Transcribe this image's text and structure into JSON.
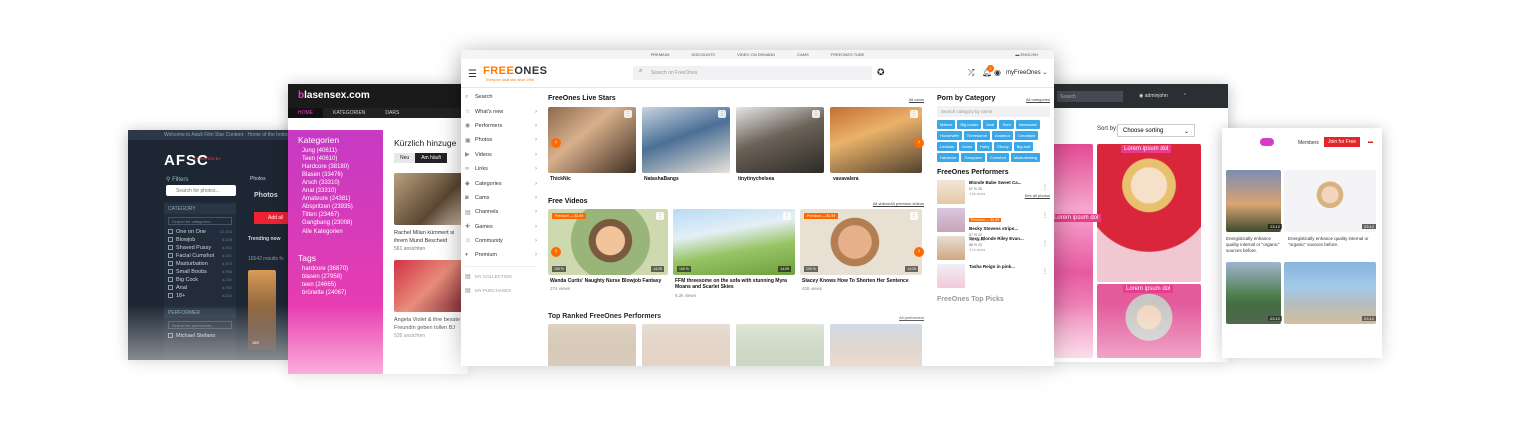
{
  "afsc": {
    "top_notice": "Welcome to Adult Film Star Content - Home of the hottest B...",
    "logo": "AFSC",
    "logo_sub": "POWERED BY",
    "filters_label": "Filters",
    "search_photos_placeholder": "Search for photos...",
    "photos_crumb": "Photos",
    "category_header": "CATEGORY",
    "category_search_placeholder": "Search for categories...",
    "categories": [
      {
        "label": "One on One",
        "count": "12,443"
      },
      {
        "label": "Blowjob",
        "count": "8,028"
      },
      {
        "label": "Shaved Pussy",
        "count": "6,542"
      },
      {
        "label": "Facial Cumshot",
        "count": "6,021"
      },
      {
        "label": "Masturbation",
        "count": "5,574"
      },
      {
        "label": "Small Boobs",
        "count": "4,996"
      },
      {
        "label": "Big Cock",
        "count": "4,232"
      },
      {
        "label": "Anal",
        "count": "3,992"
      },
      {
        "label": "18+",
        "count": "3,524"
      }
    ],
    "performer_header": "PERFORMER",
    "performer_search_placeholder": "Search for performers...",
    "performer_first": "Michael Stefano",
    "photos_title": "Photos",
    "add_button": "Add all",
    "trending_label": "Trending now",
    "results_text": "16542 results fo",
    "thumb_badge": "189"
  },
  "blasen": {
    "logo_b": "b",
    "logo_rest": "lasensex.com",
    "nav": [
      "HOME",
      "KATEGORIEN",
      "DARS"
    ],
    "categories_title": "Kategorien",
    "categories": [
      "Jung (40611)",
      "Teen (40610)",
      "Hardcore (38180)",
      "Blasen (33476)",
      "Arsch (33310)",
      "Anal (33310)",
      "Amateure (24381)",
      "Abspritzen (23935)",
      "Titten (23467)",
      "Gangbang (23008)"
    ],
    "all_categories": "Alle Kategorien",
    "tags_title": "Tags",
    "tags": [
      "hardcore (36870)",
      "blasen (27958)",
      "teen (24665)",
      "brünette (24067)"
    ],
    "recent_title": "Kürzlich hinzuge",
    "btn_new": "Neu",
    "btn_frequent": "Am häufi",
    "video1_caption": "Rachel Milan kümmert si ihrem Mund Bescheid",
    "video1_views": "561 ansichten",
    "video2_caption": "Angela Violet & ihre besste Freundin geben tollen BJ",
    "video2_views": "539 ansichten"
  },
  "rwin": {
    "search_placeholder": "Search",
    "user": "adminjohn",
    "sort_label": "Sort by:",
    "sort_value": "Choose sorting",
    "tags": [
      "Lorem ipsum dol",
      "Lorem ipsum dol",
      "Lorem ipsum dol"
    ]
  },
  "fr": {
    "members": "Members",
    "join": "Join for Free",
    "captions": [
      "Energistically enhance quality internal or \"organic\" sources before.",
      "Energistically enhance quality internal or \"organic\" sources before."
    ],
    "durations": [
      "23:12",
      "23:12",
      "23:12",
      "23:12"
    ]
  },
  "main": {
    "topbar": [
      "PREMIUM",
      "DISCOUNTS",
      "VIDEO ON DEMAND",
      "CAMS",
      "FREEONES TUBE"
    ],
    "language": "ENGLISH",
    "brand_prefix": "FREE",
    "brand_rest": "ONES",
    "tagline": "Everyone adult star since 1998",
    "search_placeholder": "Search on FreeOnes",
    "notifications": "2",
    "account_label": "myFreeOnes",
    "nav": [
      {
        "label": "Search",
        "icon": "search-icon",
        "glyph": "⌕",
        "arrow": false
      },
      {
        "label": "What's new",
        "icon": "star-icon",
        "glyph": "☆",
        "arrow": true
      },
      {
        "label": "Performers",
        "icon": "user-icon",
        "glyph": "◉",
        "arrow": true
      },
      {
        "label": "Photos",
        "icon": "image-icon",
        "glyph": "▣",
        "arrow": true
      },
      {
        "label": "Videos",
        "icon": "video-icon",
        "glyph": "▶",
        "arrow": true
      },
      {
        "label": "Links",
        "icon": "link-icon",
        "glyph": "∞",
        "arrow": true
      },
      {
        "label": "Categories",
        "icon": "tag-icon",
        "glyph": "◆",
        "arrow": true
      },
      {
        "label": "Cams",
        "icon": "camera-icon",
        "glyph": "◙",
        "arrow": true
      },
      {
        "label": "Channels",
        "icon": "channel-icon",
        "glyph": "▤",
        "arrow": true
      },
      {
        "label": "Games",
        "icon": "gamepad-icon",
        "glyph": "✚",
        "arrow": true
      },
      {
        "label": "Community",
        "icon": "community-icon",
        "glyph": "☺",
        "arrow": true
      },
      {
        "label": "Premium",
        "icon": "diamond-icon",
        "glyph": "♦",
        "arrow": true
      }
    ],
    "my_collection": "MY COLLECTION",
    "my_purchases": "MY PURCHASES",
    "live_stars_title": "FreeOnes Live Stars",
    "live_stars_all": "All cams",
    "live_stars": [
      "ThickNic",
      "NatashaBangs",
      "tinytinychelsea",
      "vavavalera"
    ],
    "free_videos_title": "Free Videos",
    "free_videos_all": "All videos",
    "free_videos_premium": "All premium videos",
    "videos": [
      {
        "caption": "Wanda Curtis' Naughty Nurse Blowjob Fantasy",
        "views": "274 views",
        "premium": "Premium — $1.99",
        "pct": "100 %",
        "dur": "14:29"
      },
      {
        "caption": "FFM threesome on the sofa with stunning Myra Moans and Scarlet Skies",
        "views": "5.2k views",
        "premium": "",
        "pct": "100 %",
        "dur": "14:29"
      },
      {
        "caption": "Stacey Knows How To Shorten Her Sentence",
        "views": "428 views",
        "premium": "Premium — $1.99",
        "pct": "100 %",
        "dur": "14:29"
      }
    ],
    "top_ranked_title": "Top Ranked FreeOnes Performers",
    "top_ranked_all": "All performers",
    "category_title": "Porn by Category",
    "category_all": "All categories",
    "category_search_placeholder": "Search category by name",
    "categories": [
      "Mature",
      "Big boobs",
      "Anal",
      "Teen",
      "Interracial",
      "Housewife",
      "Threesome",
      "Amateur",
      "Creampie",
      "Lesbian",
      "Asian",
      "Hairy",
      "Ebony",
      "Big butt",
      "Hardcore",
      "Groupsex",
      "Cumshot",
      "Masturbating"
    ],
    "performers_title": "FreeOnes Performers",
    "performers_all": "See all photos",
    "performers": [
      {
        "name": "Blonde Babe Sweet Ca...",
        "stats": "67 %  28",
        "views": "4.6k views",
        "premium": ""
      },
      {
        "name": "Becky Stevens strips...",
        "stats": "67 %  23",
        "views": "780 views",
        "premium": "Premium — $1.99"
      },
      {
        "name": "Sexy Blonde Riley Evan...",
        "stats": "88 %  23",
        "views": "3.1k views",
        "premium": ""
      },
      {
        "name": "Tasha Reign in pink...",
        "stats": "",
        "views": "",
        "premium": ""
      }
    ],
    "top_picks_title": "FreeOnes Top Picks"
  }
}
